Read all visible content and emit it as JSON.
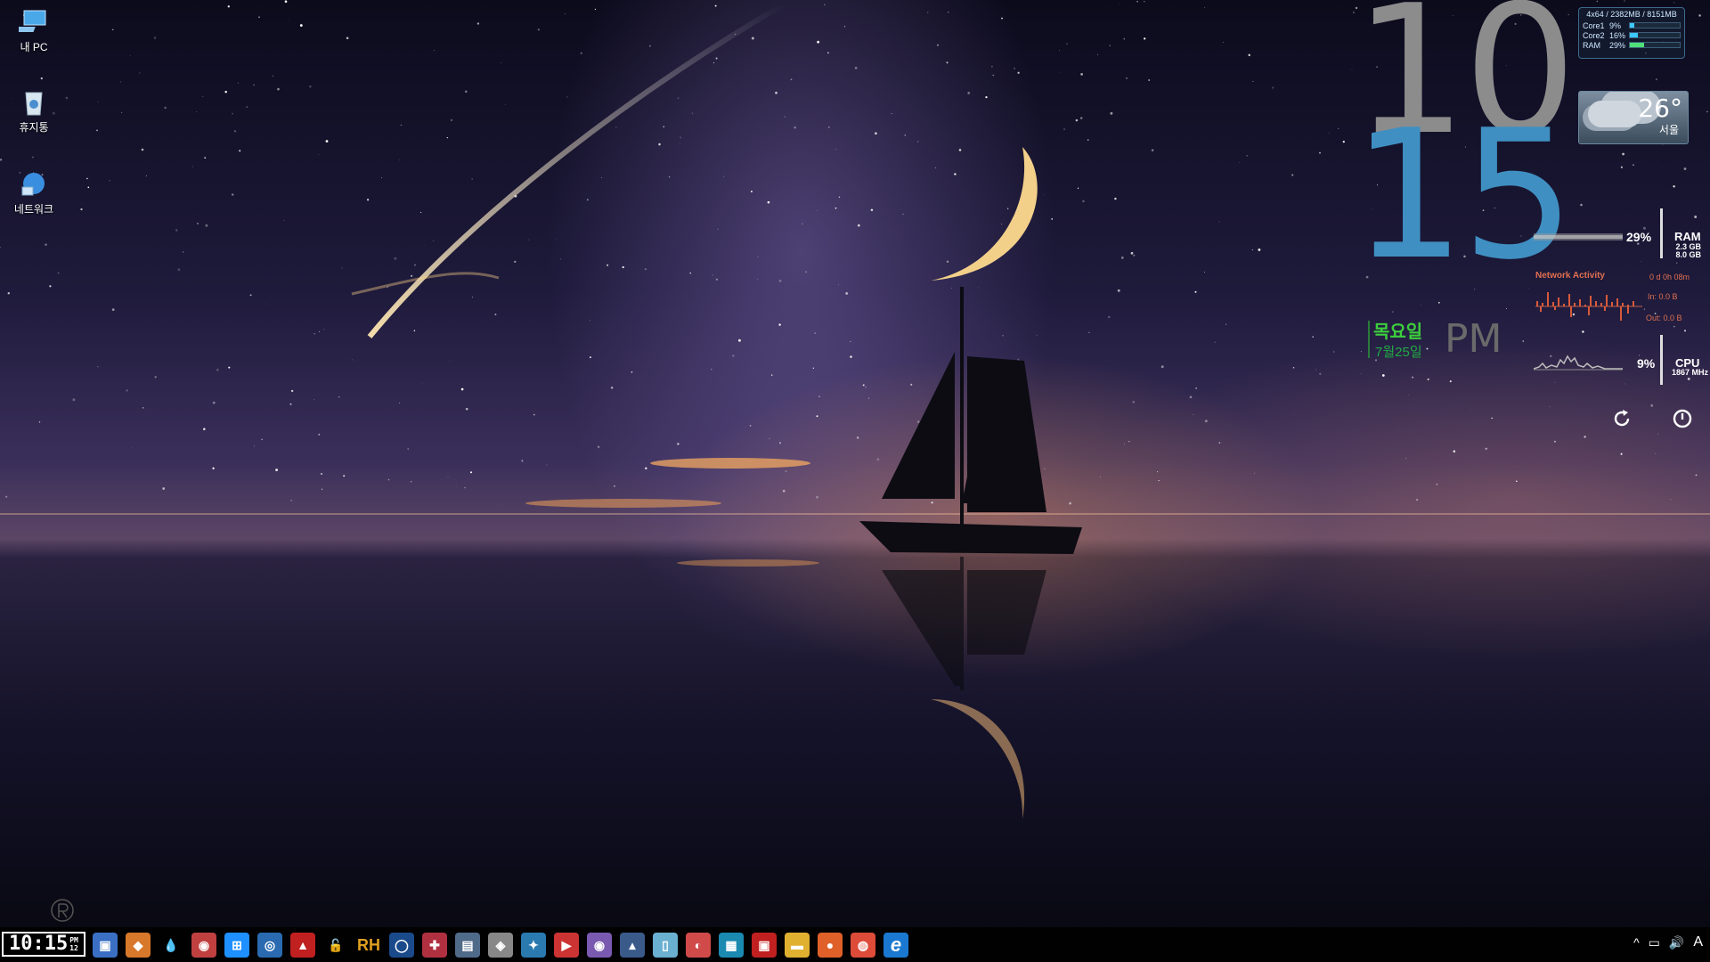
{
  "desktop": {
    "icons": [
      {
        "label": "내 PC",
        "icon": "computer-icon"
      },
      {
        "label": "휴지통",
        "icon": "recycle-bin-icon"
      },
      {
        "label": "네트워크",
        "icon": "network-icon"
      }
    ]
  },
  "clock": {
    "hour": "10",
    "minute": "15",
    "ampm": "PM",
    "day": "목요일",
    "date": "7월25일"
  },
  "sysinfo": {
    "header": "4x64 / 2382MB / 8151MB",
    "rows": [
      {
        "label": "Core1",
        "value": "9%",
        "fraction": 0.09
      },
      {
        "label": "Core2",
        "value": "16%",
        "fraction": 0.16
      },
      {
        "label": "RAM",
        "value": "29%",
        "fraction": 0.29
      }
    ]
  },
  "weather": {
    "temp": "26°",
    "city": "서울",
    "icon": "cloud-icon"
  },
  "ram_meter": {
    "percent": "29%",
    "label": "RAM",
    "used": "2.3 GB",
    "total": "8.0 GB"
  },
  "network": {
    "title": "Network Activity",
    "uptime": "0 d 0h 08m",
    "in": "In: 0.0 B",
    "out": "Out: 0.0 B"
  },
  "cpu_meter": {
    "percent": "9%",
    "label": "CPU",
    "freq": "1867 MHz"
  },
  "controls": {
    "refresh_icon": "refresh-icon",
    "power_icon": "power-icon"
  },
  "taskbar": {
    "time": "10:15",
    "ampm": "PM",
    "seconds": "12",
    "apps": [
      {
        "icon": "app-icon-1",
        "glyph": "▣",
        "color": "#3a6fc4"
      },
      {
        "icon": "app-icon-2",
        "glyph": "◆",
        "color": "#d8782a"
      },
      {
        "icon": "droplet-icon",
        "glyph": "💧",
        "color": "transparent"
      },
      {
        "icon": "globe-icon",
        "glyph": "◉",
        "color": "#c04040"
      },
      {
        "icon": "windows-icon",
        "glyph": "⊞",
        "color": "#1e90ff"
      },
      {
        "icon": "search-tool-icon",
        "glyph": "◎",
        "color": "#2a6ab0"
      },
      {
        "icon": "app-icon-7",
        "glyph": "▲",
        "color": "#c02020"
      },
      {
        "icon": "lock-icon",
        "glyph": "🔓",
        "color": "transparent"
      },
      {
        "icon": "rh-icon",
        "glyph": "RH",
        "color": "transparent"
      },
      {
        "icon": "circle-icon",
        "glyph": "◯",
        "color": "#1a4a8a"
      },
      {
        "icon": "gift-icon",
        "glyph": "✚",
        "color": "#b03040"
      },
      {
        "icon": "app-icon-12",
        "glyph": "▤",
        "color": "#506a8a"
      },
      {
        "icon": "diamond-icon",
        "glyph": "◈",
        "color": "#888888"
      },
      {
        "icon": "app-icon-14",
        "glyph": "✦",
        "color": "#2a7ab0"
      },
      {
        "icon": "app-icon-15",
        "glyph": "▶",
        "color": "#cc3333"
      },
      {
        "icon": "disc-icon",
        "glyph": "◉",
        "color": "#7a5ab0"
      },
      {
        "icon": "app-icon-17",
        "glyph": "▴",
        "color": "#3a5a8a"
      },
      {
        "icon": "tablet-icon",
        "glyph": "▯",
        "color": "#6ab0d0"
      },
      {
        "icon": "app-icon-19",
        "glyph": "◐",
        "color": "#d04a4a"
      },
      {
        "icon": "app-icon-20",
        "glyph": "▦",
        "color": "#1a8ab0"
      },
      {
        "icon": "app-icon-21",
        "glyph": "▣",
        "color": "#c02020"
      },
      {
        "icon": "folder-icon",
        "glyph": "▬",
        "color": "#e0b030"
      },
      {
        "icon": "firefox-icon",
        "glyph": "●",
        "color": "#e0602a"
      },
      {
        "icon": "chrome-icon",
        "glyph": "◍",
        "color": "#dd4b39"
      },
      {
        "icon": "ie-icon",
        "glyph": "e",
        "color": "#1a78d0"
      }
    ],
    "tray": {
      "chevron": "^",
      "network": "▭",
      "volume": "🔊",
      "ime": "A"
    }
  }
}
